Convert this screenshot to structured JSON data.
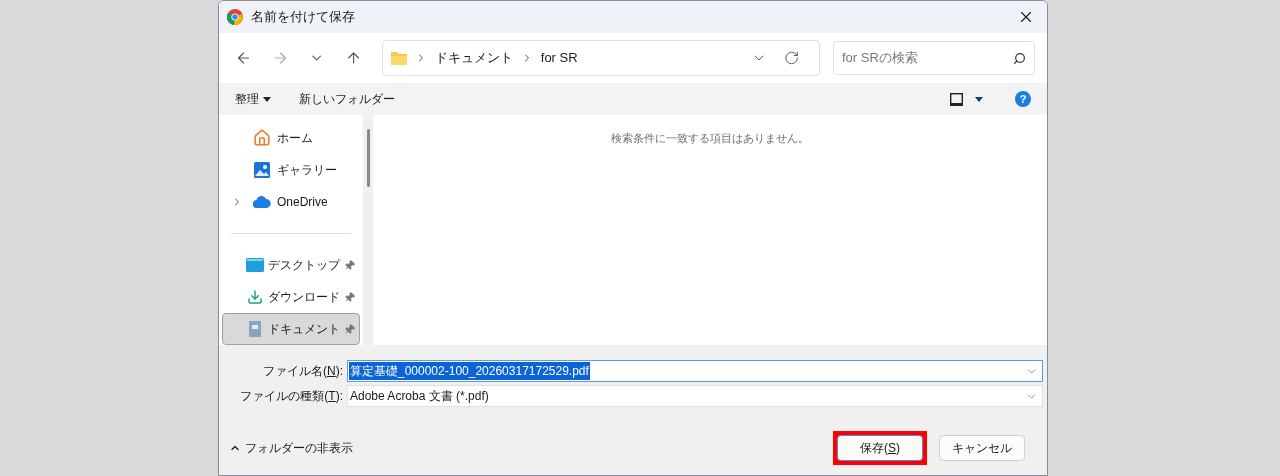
{
  "window": {
    "title": "名前を付けて保存"
  },
  "address_bar": {
    "path": [
      "ドキュメント",
      "for SR"
    ]
  },
  "search": {
    "placeholder": "for SRの検索"
  },
  "toolbar": {
    "organize": "整理",
    "new_folder": "新しいフォルダー",
    "help": "?"
  },
  "sidebar": {
    "items": [
      {
        "kind": "home",
        "label": "ホーム",
        "pinned": false,
        "expandable": false,
        "selected": false
      },
      {
        "kind": "gallery",
        "label": "ギャラリー",
        "pinned": false,
        "expandable": false,
        "selected": false
      },
      {
        "kind": "cloud",
        "label": "OneDrive",
        "pinned": false,
        "expandable": true,
        "selected": false
      },
      {
        "kind": "divider"
      },
      {
        "kind": "desktop",
        "label": "デスクトップ",
        "pinned": true,
        "expandable": false,
        "selected": false
      },
      {
        "kind": "download",
        "label": "ダウンロード",
        "pinned": true,
        "expandable": false,
        "selected": false
      },
      {
        "kind": "document",
        "label": "ドキュメント",
        "pinned": true,
        "expandable": false,
        "selected": true
      }
    ]
  },
  "empty_message": "検索条件に一致する項目はありません。",
  "fields": [
    {
      "label_before": "ファイル名(",
      "accesskey": "N",
      "label_after": "):",
      "value": "算定基礎_000002-100_20260317172529.pdf",
      "text_selected": true,
      "focused": true
    },
    {
      "label_before": "ファイルの種類(",
      "accesskey": "T",
      "label_after": "):",
      "value": "Adobe Acroba 文書 (*.pdf)",
      "text_selected": false,
      "focused": false
    }
  ],
  "hide_folders": "フォルダーの非表示",
  "buttons": [
    {
      "label_before": "保存(",
      "accesskey": "S",
      "label_after": ")",
      "highlighted": true,
      "default": true
    },
    {
      "label_before": "キャンセル",
      "highlighted": false,
      "default": false
    }
  ]
}
